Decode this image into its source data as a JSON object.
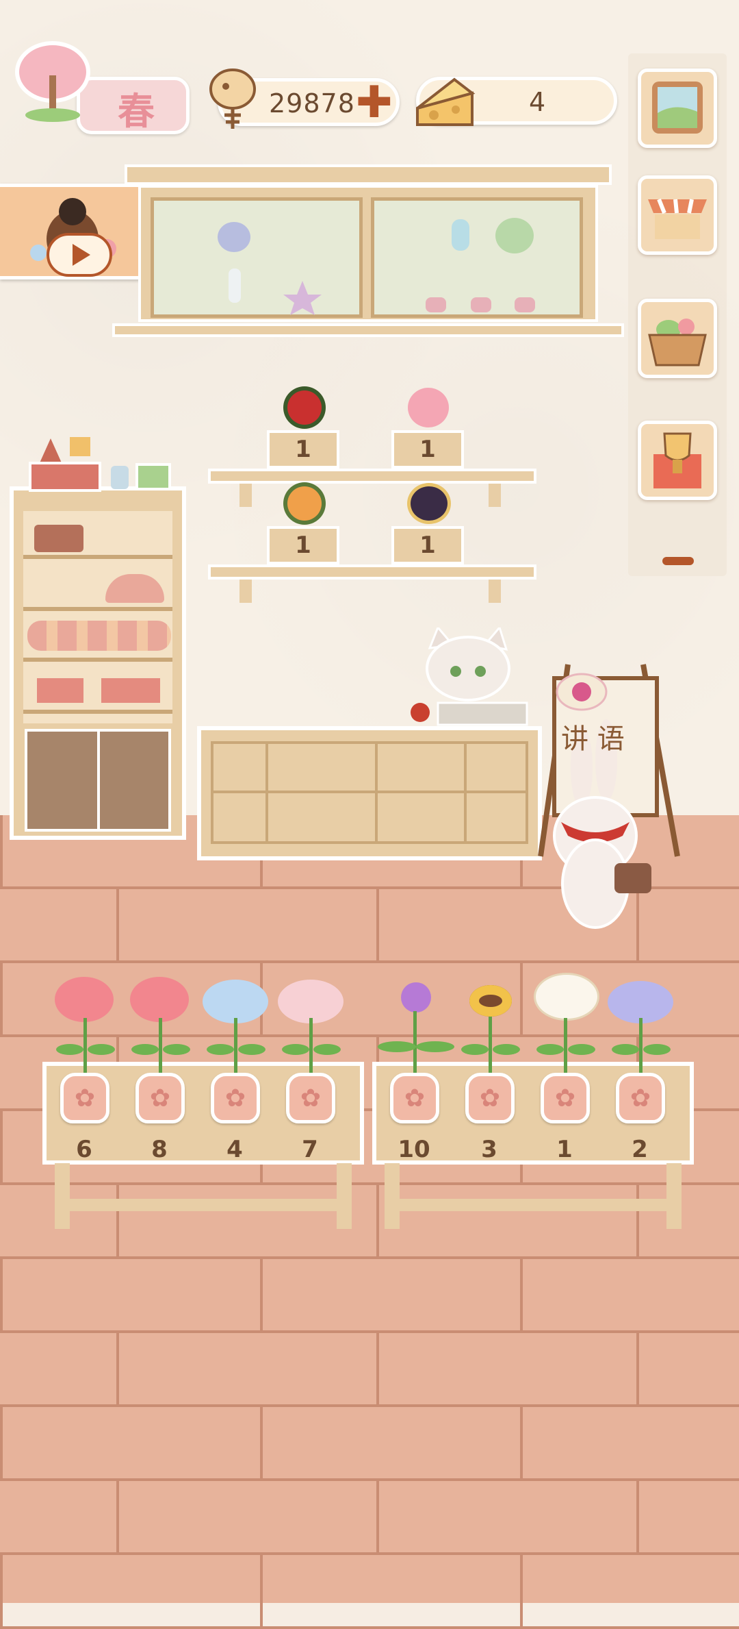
{
  "hud": {
    "season_label": "春",
    "fish_coins": "29878",
    "cheese": "4"
  },
  "sign": {
    "text": "讲 语"
  },
  "display_shelf": {
    "boxes": [
      {
        "count": "1",
        "bouquet": "red-bouquet"
      },
      {
        "count": "1",
        "bouquet": "pink-bouquet"
      },
      {
        "count": "1",
        "bouquet": "orange-bouquet"
      },
      {
        "count": "1",
        "bouquet": "purple-bouquet"
      }
    ]
  },
  "flower_stand": {
    "left": [
      {
        "count": "6",
        "flower": "pink-rose"
      },
      {
        "count": "8",
        "flower": "pink-rose"
      },
      {
        "count": "4",
        "flower": "blue-hydrangea"
      },
      {
        "count": "7",
        "flower": "pink-hydrangea"
      }
    ],
    "right": [
      {
        "count": "10",
        "flower": "purple-tulip"
      },
      {
        "count": "3",
        "flower": "sunflower"
      },
      {
        "count": "1",
        "flower": "white-daisy"
      },
      {
        "count": "2",
        "flower": "purple-hydrangea"
      }
    ]
  },
  "colors": {
    "accent": "#b4562a",
    "wall": "#f7f0e6",
    "floor": "#e7b39b",
    "wood": "#e8cea6"
  }
}
